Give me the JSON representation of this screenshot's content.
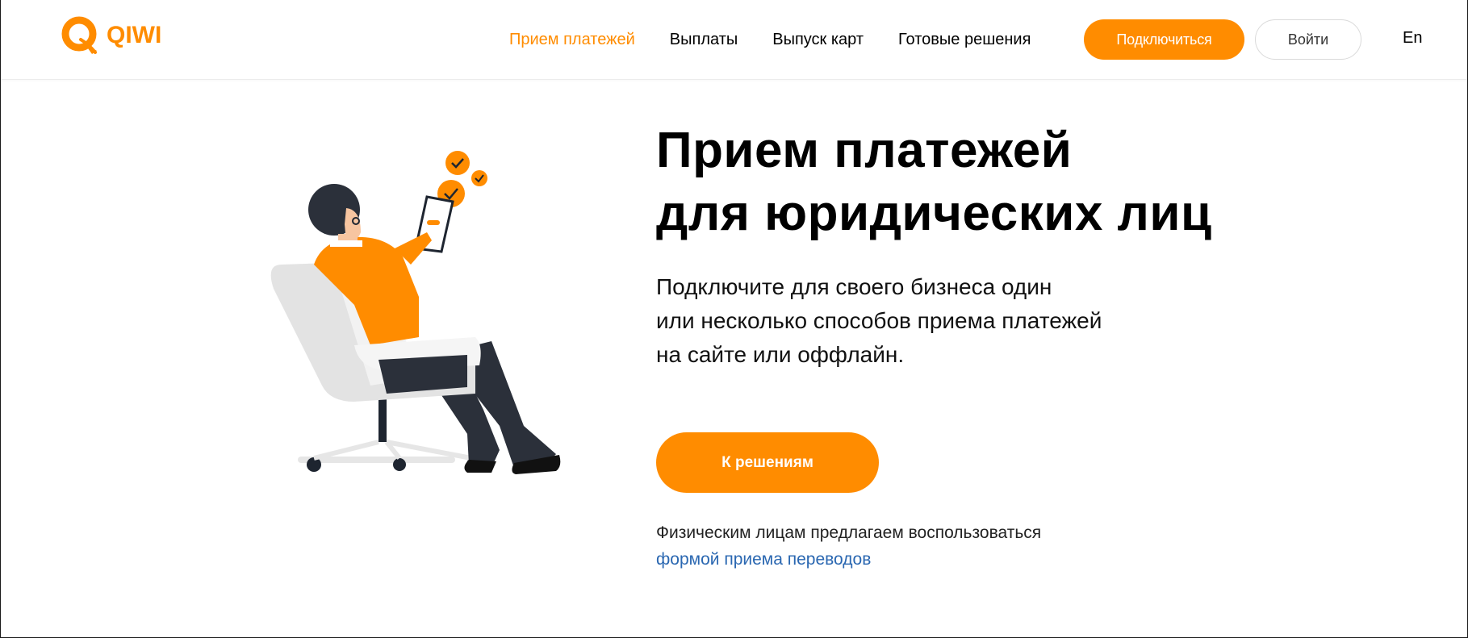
{
  "brand": {
    "name": "QIWI",
    "accent_color": "#ff8c00",
    "link_color": "#2a67b1"
  },
  "nav": {
    "items": [
      {
        "label": "Прием платежей",
        "active": true
      },
      {
        "label": "Выплаты",
        "active": false
      },
      {
        "label": "Выпуск карт",
        "active": false
      },
      {
        "label": "Готовые решения",
        "active": false
      }
    ],
    "connect_label": "Подключиться",
    "login_label": "Войти",
    "lang_label": "En"
  },
  "hero": {
    "title_line1": "Прием платежей",
    "title_line2": "для юридических лиц",
    "subtitle_line1": "Подключите для своего бизнеса один",
    "subtitle_line2": "или несколько способов приема платежей",
    "subtitle_line3": "на сайте или оффлайн.",
    "cta_label": "К решениям",
    "note_text": "Физическим лицам предлагаем воспользоваться",
    "note_link": "формой приема переводов"
  },
  "illustration": {
    "icon": "person-in-chair-with-tablet-illustration"
  }
}
